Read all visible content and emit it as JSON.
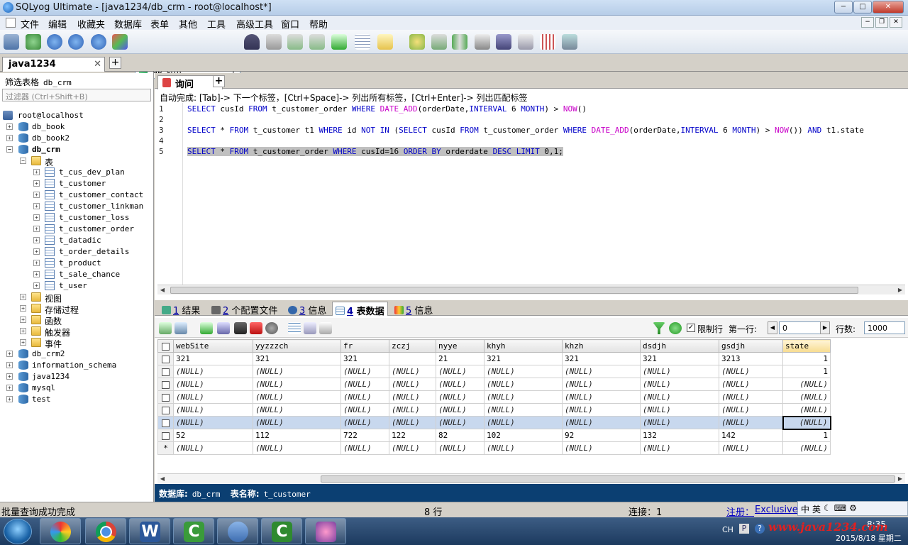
{
  "window": {
    "title": "SQLyog Ultimate - [java1234/db_crm - root@localhost*]",
    "controls": [
      "−",
      "□",
      "✕"
    ]
  },
  "menu": [
    "文件",
    "编辑",
    "收藏夹",
    "数据库",
    "表单",
    "其他",
    "工具",
    "高级工具",
    "窗口",
    "帮助"
  ],
  "toolbar": {
    "db_selector": "db_crm"
  },
  "connection_tab": {
    "label": "java1234",
    "close": "✕",
    "add": "+"
  },
  "object_browser": {
    "filter_label": "筛选表格",
    "filter_db": "db_crm",
    "filter_placeholder": "过滤器 (Ctrl+Shift+B)",
    "root": "root@localhost",
    "databases": [
      "db_book",
      "db_book2",
      "db_crm",
      "db_crm2",
      "information_schema",
      "java1234",
      "mysql",
      "test"
    ],
    "tables_folder": "表",
    "tables": [
      "t_cus_dev_plan",
      "t_customer",
      "t_customer_contact",
      "t_customer_linkman",
      "t_customer_loss",
      "t_customer_order",
      "t_datadic",
      "t_order_details",
      "t_product",
      "t_sale_chance",
      "t_user"
    ],
    "other_folders": [
      "视图",
      "存储过程",
      "函数",
      "触发器",
      "事件"
    ]
  },
  "query": {
    "tab_label": "询问",
    "autocomplete_hint": "自动完成: [Tab]-> 下一个标签，[Ctrl+Space]-> 列出所有标签，[Ctrl+Enter]-> 列出匹配标签",
    "line_numbers": [
      "1",
      "2",
      "3",
      "4",
      "5"
    ]
  },
  "result_tabs": [
    {
      "num": "1",
      "label": "结果"
    },
    {
      "num": "2",
      "label": "个配置文件"
    },
    {
      "num": "3",
      "label": "信息"
    },
    {
      "num": "4",
      "label": "表数据"
    },
    {
      "num": "5",
      "label": "信息"
    }
  ],
  "grid_toolbar": {
    "limit_label": "限制行",
    "first_row_label": "第一行:",
    "first_row": "0",
    "rows_label": "行数:",
    "rows": "1000"
  },
  "grid": {
    "columns": [
      "webSite",
      "yyzzzch",
      "fr",
      "zczj",
      "nyye",
      "khyh",
      "khzh",
      "dsdjh",
      "gsdjh",
      "state"
    ],
    "rows": [
      [
        "321",
        "321",
        "321",
        "",
        "21",
        "321",
        "321",
        "321",
        "3213",
        "1"
      ],
      [
        "(NULL)",
        "(NULL)",
        "(NULL)",
        "(NULL)",
        "(NULL)",
        "(NULL)",
        "(NULL)",
        "(NULL)",
        "(NULL)",
        "1"
      ],
      [
        "(NULL)",
        "(NULL)",
        "(NULL)",
        "(NULL)",
        "(NULL)",
        "(NULL)",
        "(NULL)",
        "(NULL)",
        "(NULL)",
        "(NULL)"
      ],
      [
        "(NULL)",
        "(NULL)",
        "(NULL)",
        "(NULL)",
        "(NULL)",
        "(NULL)",
        "(NULL)",
        "(NULL)",
        "(NULL)",
        "(NULL)"
      ],
      [
        "(NULL)",
        "(NULL)",
        "(NULL)",
        "(NULL)",
        "(NULL)",
        "(NULL)",
        "(NULL)",
        "(NULL)",
        "(NULL)",
        "(NULL)"
      ],
      [
        "(NULL)",
        "(NULL)",
        "(NULL)",
        "(NULL)",
        "(NULL)",
        "(NULL)",
        "(NULL)",
        "(NULL)",
        "(NULL)",
        "(NULL)"
      ],
      [
        "52",
        "112",
        "722",
        "122",
        "82",
        "102",
        "92",
        "132",
        "142",
        "1"
      ],
      [
        "(NULL)",
        "(NULL)",
        "(NULL)",
        "(NULL)",
        "(NULL)",
        "(NULL)",
        "(NULL)",
        "(NULL)",
        "(NULL)",
        "(NULL)"
      ]
    ],
    "new_row_marker": "*"
  },
  "info_bar": {
    "db_label": "数据库:",
    "db": "db_crm",
    "table_label": "表名称:",
    "table": "t_customer"
  },
  "status": {
    "message": "批量查询成功完成",
    "rows": "8 行",
    "connection": "连接：1",
    "register": "注册：",
    "edition": "Exclusive I"
  },
  "ime": [
    "中",
    "英"
  ],
  "taskbar": {
    "apps": [
      "W",
      "C",
      "C"
    ],
    "lang": "CH",
    "time": "8:35",
    "date": "2015/8/18 星期二",
    "watermark": "www.java1234.com"
  }
}
